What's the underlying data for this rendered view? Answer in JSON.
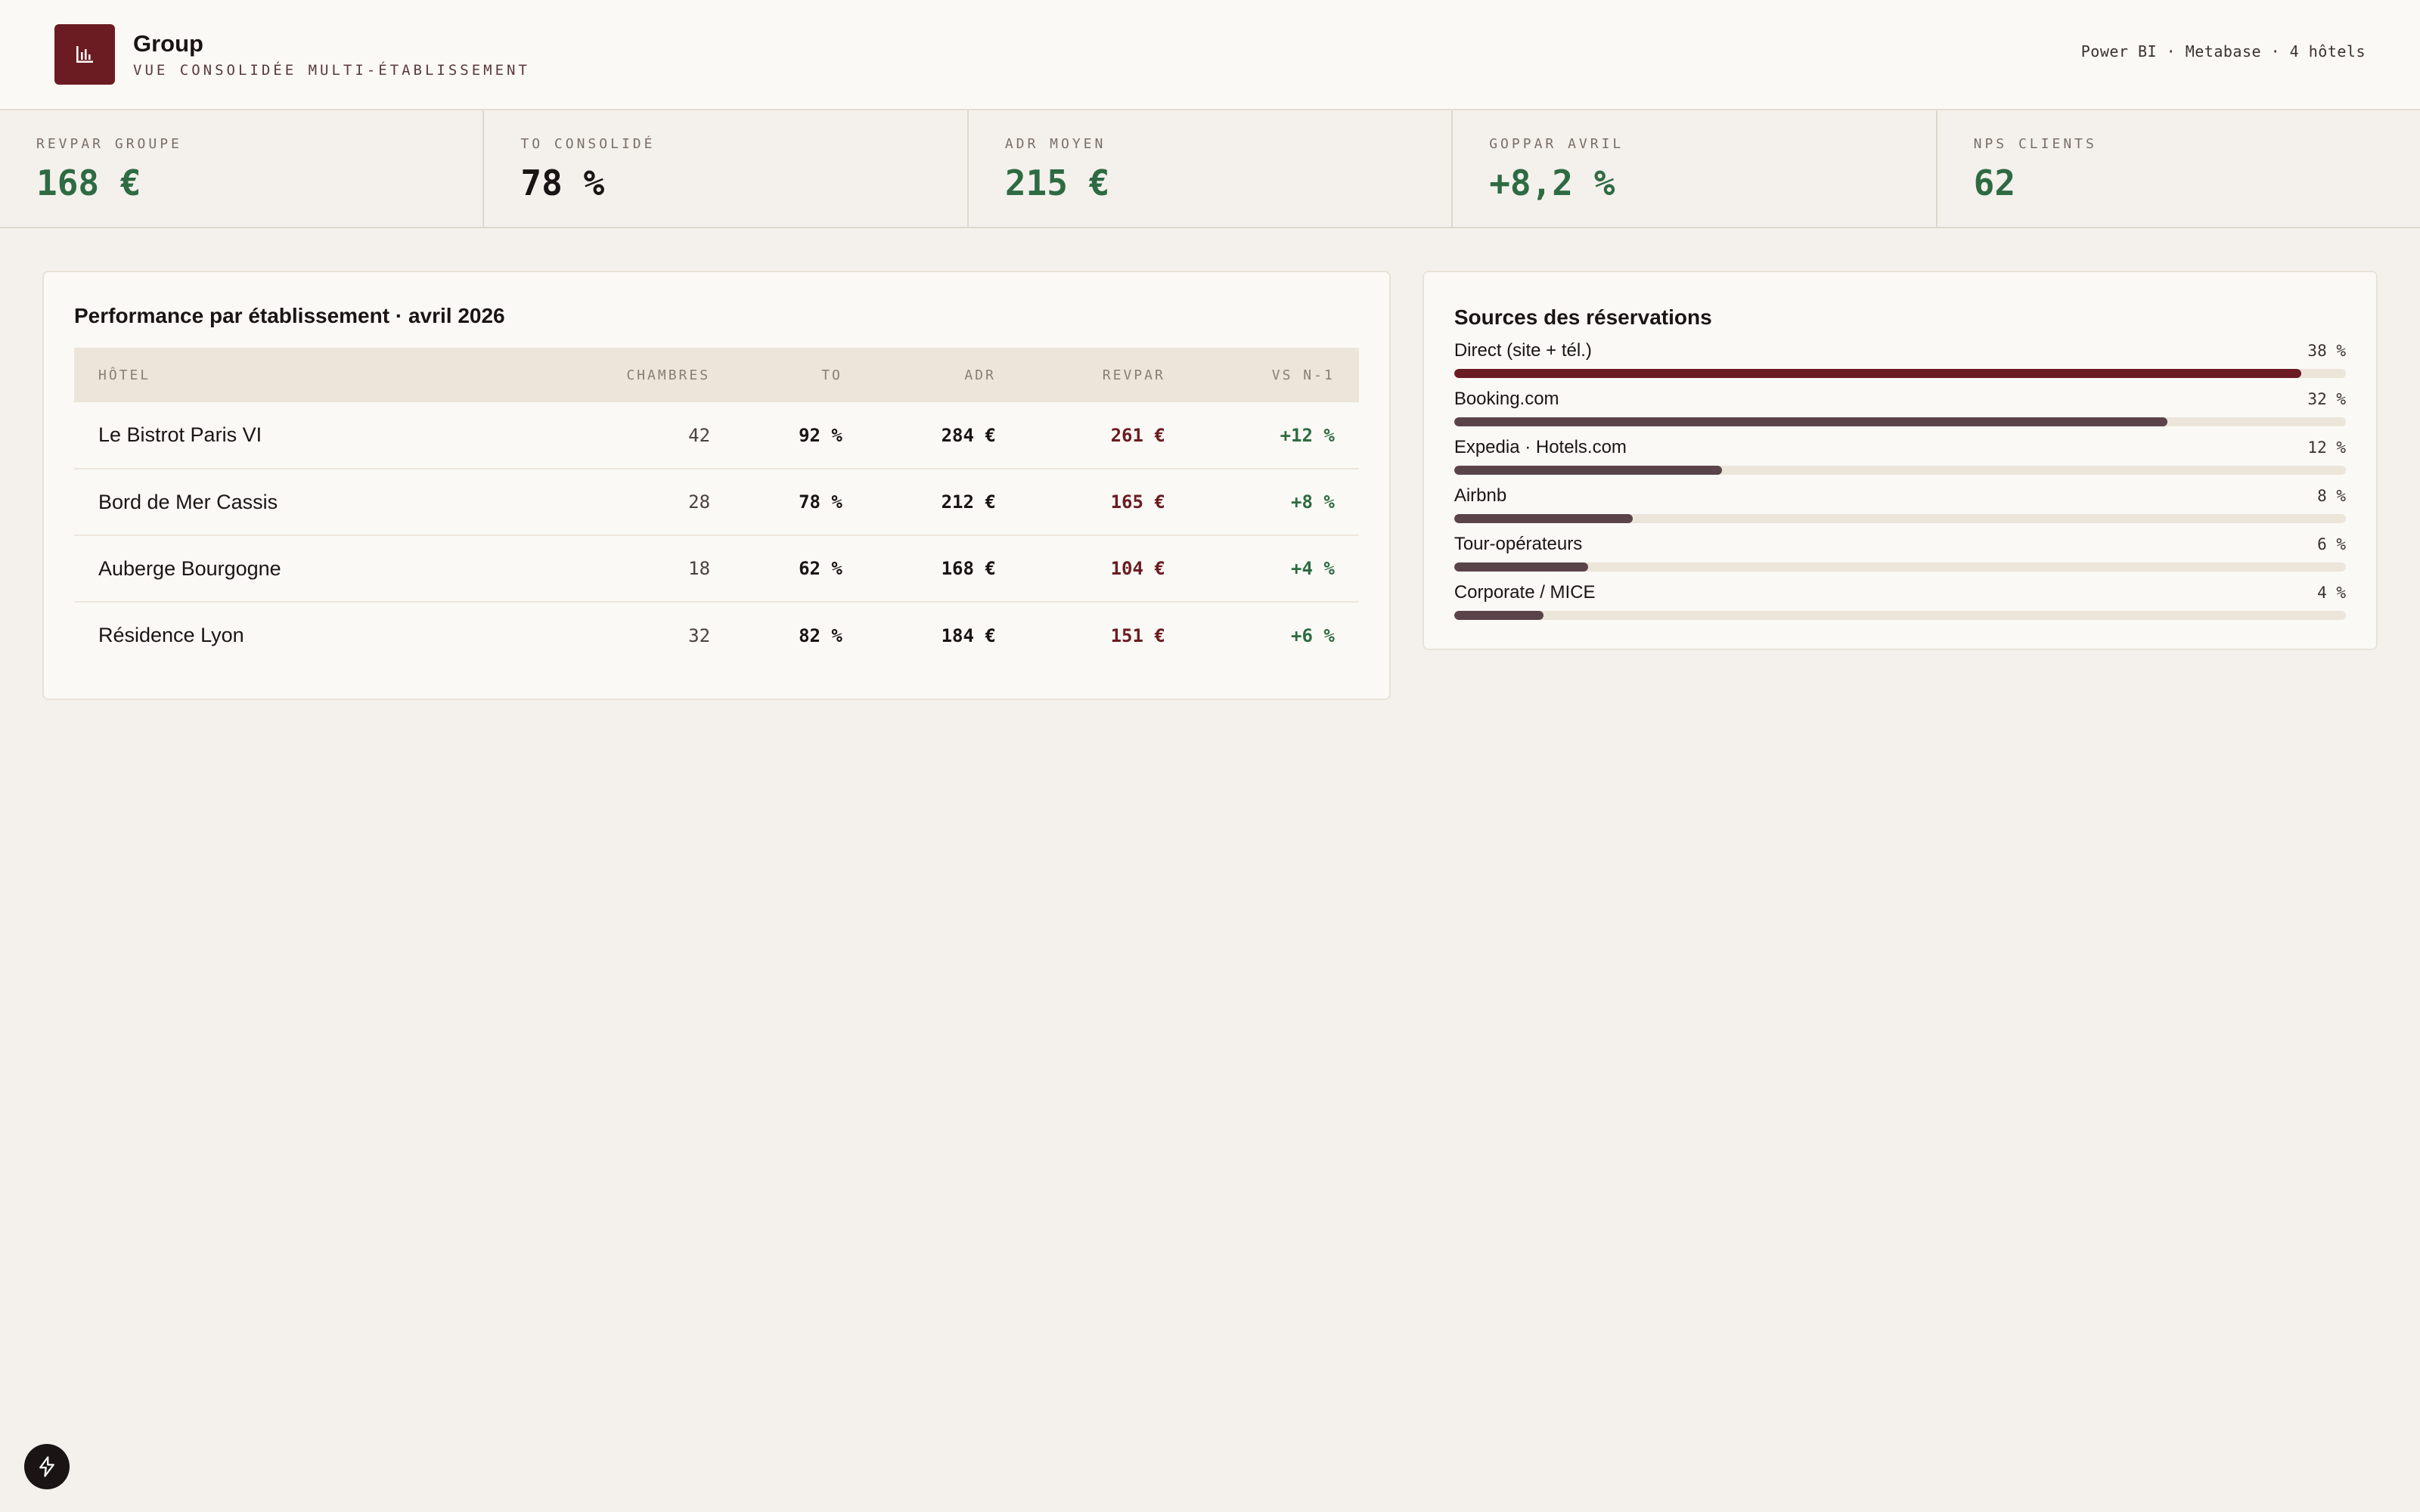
{
  "header": {
    "title": "Group",
    "subtitle": "VUE CONSOLIDÉE MULTI-ÉTABLISSEMENT",
    "meta": "Power BI · Metabase · 4 hôtels",
    "logo_icon": "bar-chart-icon",
    "brand_color": "#6b1c22"
  },
  "kpis": [
    {
      "label": "REVPAR GROUPE",
      "value": "168 €",
      "tone": "green"
    },
    {
      "label": "TO CONSOLIDÉ",
      "value": "78 %",
      "tone": "dark"
    },
    {
      "label": "ADR MOYEN",
      "value": "215 €",
      "tone": "green"
    },
    {
      "label": "GOPPAR AVRIL",
      "value": "+8,2 %",
      "tone": "green"
    },
    {
      "label": "NPS CLIENTS",
      "value": "62",
      "tone": "green"
    }
  ],
  "performance": {
    "title": "Performance par établissement · avril 2026",
    "columns": [
      "HÔTEL",
      "CHAMBRES",
      "TO",
      "ADR",
      "REVPAR",
      "VS N-1"
    ],
    "rows": [
      [
        "Le Bistrot Paris VI",
        "42",
        "92 %",
        "284 €",
        "261 €",
        "+12 %"
      ],
      [
        "Bord de Mer Cassis",
        "28",
        "78 %",
        "212 €",
        "165 €",
        "+8 %"
      ],
      [
        "Auberge Bourgogne",
        "18",
        "62 %",
        "168 €",
        "104 €",
        "+4 %"
      ],
      [
        "Résidence Lyon",
        "32",
        "82 %",
        "184 €",
        "151 €",
        "+6 %"
      ]
    ]
  },
  "sources": {
    "title": "Sources des réservations",
    "items": [
      {
        "label": "Direct (site + tél.)",
        "pct": "38 %",
        "fill": 0.95,
        "color": "#6b1c22"
      },
      {
        "label": "Booking.com",
        "pct": "32 %",
        "fill": 0.8,
        "color": "#5a444a"
      },
      {
        "label": "Expedia · Hotels.com",
        "pct": "12 %",
        "fill": 0.3,
        "color": "#5a444a"
      },
      {
        "label": "Airbnb",
        "pct": "8 %",
        "fill": 0.2,
        "color": "#5a444a"
      },
      {
        "label": "Tour-opérateurs",
        "pct": "6 %",
        "fill": 0.15,
        "color": "#5a444a"
      },
      {
        "label": "Corporate / MICE",
        "pct": "4 %",
        "fill": 0.1,
        "color": "#5a444a"
      }
    ]
  },
  "fab": {
    "icon": "lightning-icon"
  }
}
